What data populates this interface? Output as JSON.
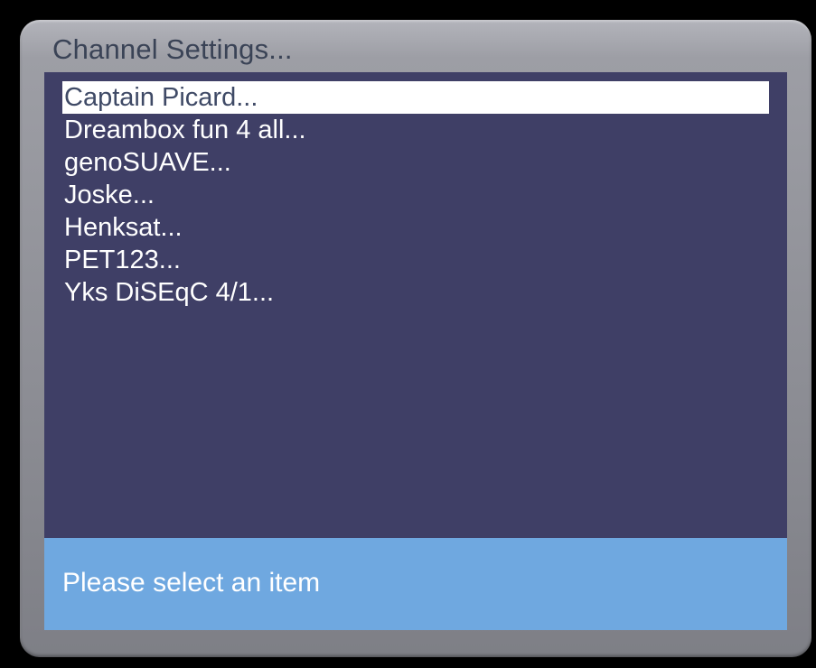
{
  "window": {
    "title": "Channel Settings..."
  },
  "menu": {
    "selected_index": 0,
    "items": [
      {
        "label": "Captain Picard..."
      },
      {
        "label": "Dreambox fun 4 all..."
      },
      {
        "label": "genoSUAVE..."
      },
      {
        "label": "Joske..."
      },
      {
        "label": "Henksat..."
      },
      {
        "label": "PET123..."
      },
      {
        "label": "Yks DiSEqC 4/1..."
      }
    ]
  },
  "status": {
    "text": "Please select an item"
  },
  "colors": {
    "background": "#000000",
    "window_frame": "#8f9097",
    "title_text": "#3a4356",
    "list_background": "#3f3f66",
    "selection_background": "#ffffff",
    "selection_text": "#3f4a66",
    "status_background": "#6fa8e0",
    "text": "#ffffff"
  }
}
